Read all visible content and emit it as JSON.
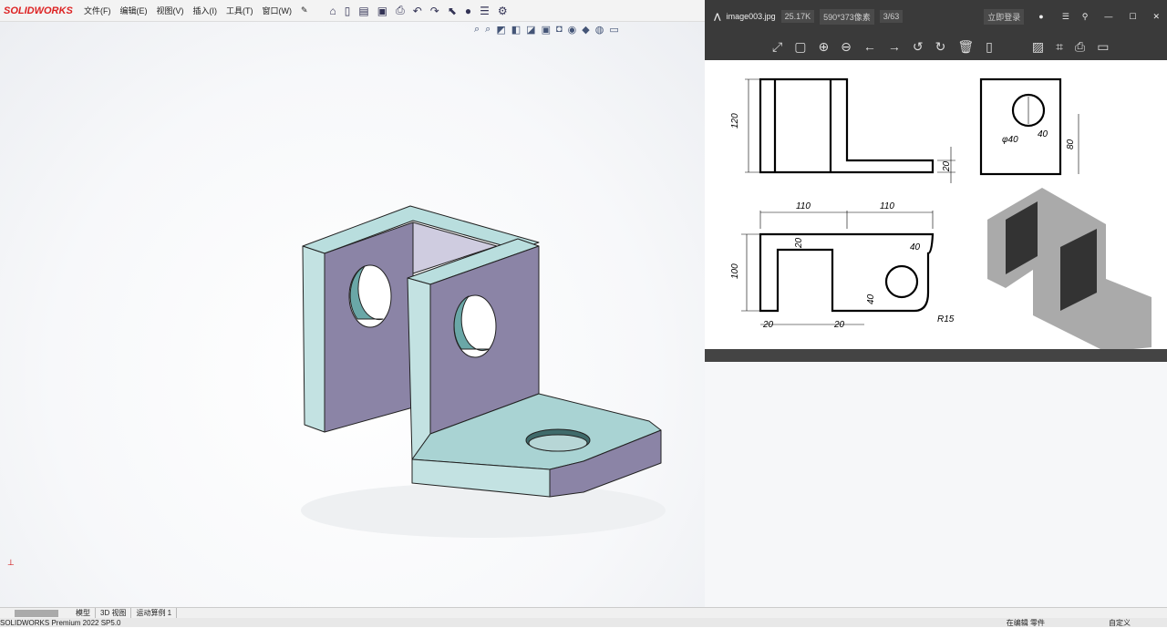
{
  "app": {
    "logo": "SOLIDWORKS",
    "menus": [
      "文件(F)",
      "编辑(E)",
      "视图(V)",
      "插入(I)",
      "工具(T)",
      "窗口(W)"
    ]
  },
  "viewer": {
    "filename": "image003.jpg",
    "size": "25.17K",
    "dimensions": "590*373像素",
    "index": "3/63",
    "login": "立即登录"
  },
  "drawing": {
    "dims": [
      "120",
      "20",
      "φ40",
      "40",
      "80",
      "110",
      "110",
      "20",
      "100",
      "40",
      "20",
      "20",
      "40",
      "R15"
    ]
  },
  "tabs": [
    "模型",
    "3D 视图",
    "运动算例 1"
  ],
  "status": {
    "version": "SOLIDWORKS Premium 2022 SP5.0",
    "mode": "在编辑 零件",
    "units": "自定义"
  }
}
